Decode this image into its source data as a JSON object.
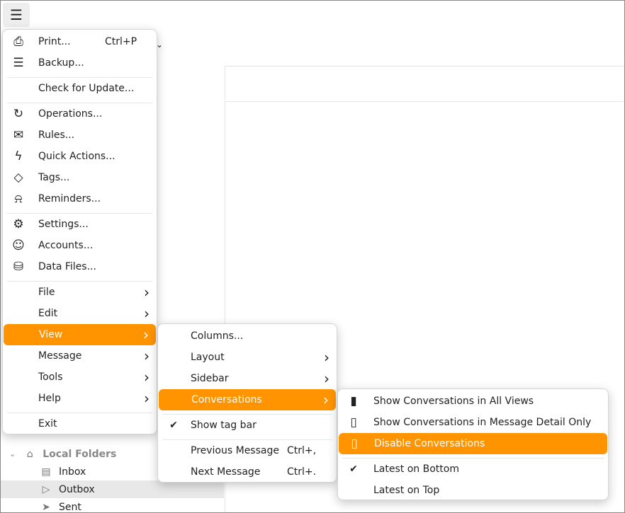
{
  "app": {
    "menu_icon": "hamburger-icon"
  },
  "sidebar": {
    "local_folders": "Local Folders",
    "folders": [
      "Inbox",
      "Outbox",
      "Sent"
    ]
  },
  "main_menu": {
    "items": [
      {
        "label": "Print...",
        "shortcut": "Ctrl+P",
        "icon": "printer-icon"
      },
      {
        "label": "Backup...",
        "icon": "backup-icon"
      },
      {
        "sep": true
      },
      {
        "label": "Check for Update..."
      },
      {
        "sep": true
      },
      {
        "label": "Operations...",
        "icon": "sync-icon"
      },
      {
        "label": "Rules...",
        "icon": "rules-icon"
      },
      {
        "label": "Quick Actions...",
        "icon": "lightning-icon"
      },
      {
        "label": "Tags...",
        "icon": "tag-icon"
      },
      {
        "label": "Reminders...",
        "icon": "bell-icon"
      },
      {
        "sep": true
      },
      {
        "label": "Settings...",
        "icon": "gear-icon"
      },
      {
        "label": "Accounts...",
        "icon": "accounts-icon"
      },
      {
        "label": "Data Files...",
        "icon": "database-icon"
      },
      {
        "sep": true
      },
      {
        "label": "File",
        "submenu": true
      },
      {
        "label": "Edit",
        "submenu": true
      },
      {
        "label": "View",
        "submenu": true,
        "highlighted": true
      },
      {
        "label": "Message",
        "submenu": true
      },
      {
        "label": "Tools",
        "submenu": true
      },
      {
        "label": "Help",
        "submenu": true
      },
      {
        "sep": true
      },
      {
        "label": "Exit"
      }
    ]
  },
  "view_menu": {
    "items": [
      {
        "label": "Columns..."
      },
      {
        "label": "Layout",
        "submenu": true
      },
      {
        "label": "Sidebar",
        "submenu": true
      },
      {
        "label": "Conversations",
        "submenu": true,
        "highlighted": true
      },
      {
        "sep": true
      },
      {
        "label": "Show tag bar",
        "checked": true
      },
      {
        "sep": true
      },
      {
        "label": "Previous Message",
        "shortcut": "Ctrl+,"
      },
      {
        "label": "Next Message",
        "shortcut": "Ctrl+."
      }
    ]
  },
  "conversations_menu": {
    "items": [
      {
        "label": "Show Conversations in All Views",
        "icon": "conversations-all-icon"
      },
      {
        "label": "Show Conversations in Message Detail Only",
        "icon": "conversations-detail-icon"
      },
      {
        "label": "Disable Conversations",
        "icon": "conversations-off-icon",
        "highlighted": true
      },
      {
        "sep": true
      },
      {
        "label": "Latest on Bottom",
        "checked": true
      },
      {
        "label": "Latest on Top"
      }
    ]
  },
  "colors": {
    "accent": "#ff9400"
  }
}
